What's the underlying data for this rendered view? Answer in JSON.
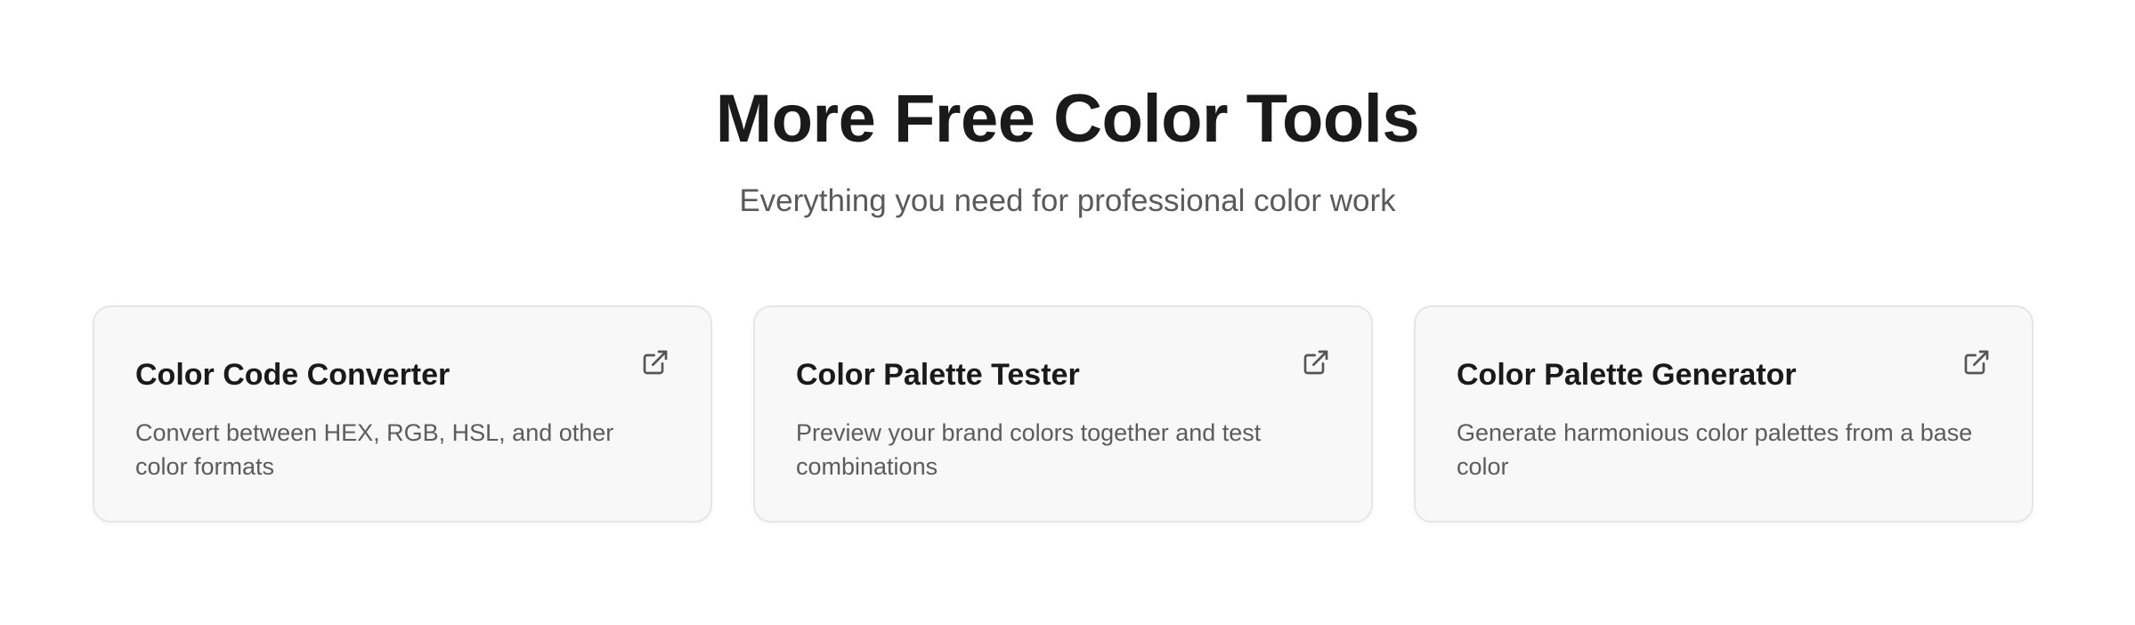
{
  "section": {
    "title": "More Free Color Tools",
    "subtitle": "Everything you need for professional color work"
  },
  "cards": [
    {
      "title": "Color Code Converter",
      "description": "Convert between HEX, RGB, HSL, and other color formats",
      "icon": "external-link-icon"
    },
    {
      "title": "Color Palette Tester",
      "description": "Preview your brand colors together and test combinations",
      "icon": "external-link-icon"
    },
    {
      "title": "Color Palette Generator",
      "description": "Generate harmonious color palettes from a base color",
      "icon": "external-link-icon"
    }
  ],
  "colors": {
    "heading": "#1a1a1a",
    "subtext": "#5a5a5a",
    "card_background": "#f8f8f8",
    "card_border": "#e6e6e6",
    "icon": "#555555"
  }
}
